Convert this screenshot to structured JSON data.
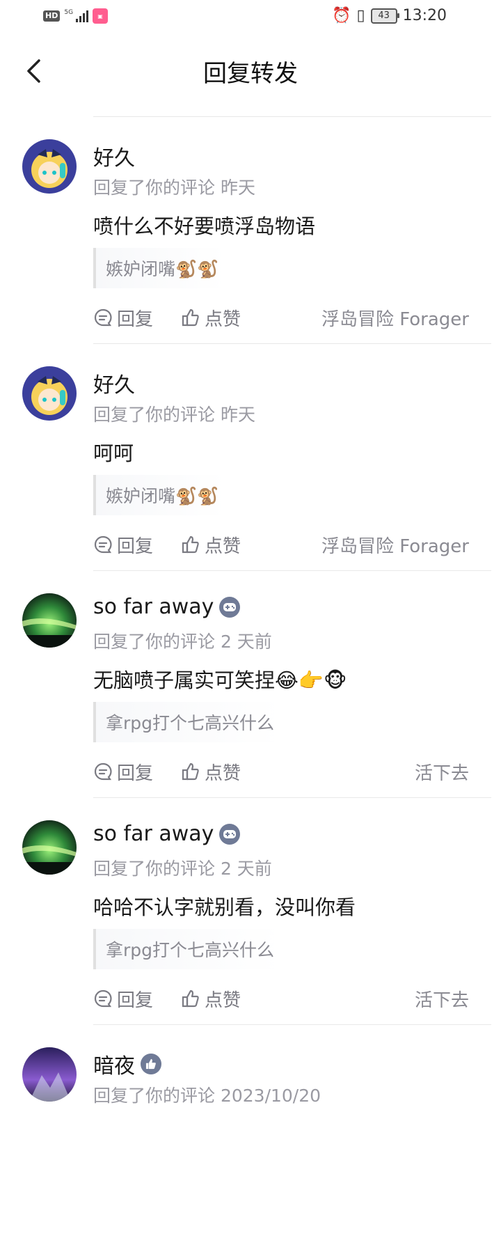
{
  "status_bar": {
    "hd": "HD",
    "network": "5G",
    "time": "13:20",
    "battery": "43"
  },
  "header": {
    "title": "回复转发"
  },
  "items": [
    {
      "name": "好久",
      "meta": "回复了你的评论 昨天",
      "text": "喷什么不好要喷浮岛物语",
      "quote": "嫉妒闭嘴🐒🐒",
      "reply_label": "回复",
      "like_label": "点赞",
      "source": "浮岛冒险 Forager",
      "avatar": "anime-girl-avatar"
    },
    {
      "name": "好久",
      "meta": "回复了你的评论 昨天",
      "text": "呵呵",
      "quote": "嫉妒闭嘴🐒🐒",
      "reply_label": "回复",
      "like_label": "点赞",
      "source": "浮岛冒险 Forager",
      "avatar": "anime-girl-avatar"
    },
    {
      "name": "so far away",
      "meta": "回复了你的评论 2 天前",
      "text": "无脑喷子属实可笑捏😂👉🐵",
      "quote": "拿rpg打个七高兴什么",
      "reply_label": "回复",
      "like_label": "点赞",
      "source": "活下去",
      "avatar": "aurora-avatar",
      "badge": "gamepad-icon"
    },
    {
      "name": "so far away",
      "meta": "回复了你的评论 2 天前",
      "text": "哈哈不认字就别看，没叫你看",
      "quote": "拿rpg打个七高兴什么",
      "reply_label": "回复",
      "like_label": "点赞",
      "source": "活下去",
      "avatar": "aurora-avatar",
      "badge": "gamepad-icon"
    },
    {
      "name": "暗夜",
      "meta": "回复了你的评论 2023/10/20",
      "avatar": "purple-aurora-avatar",
      "badge": "thumb-badge-icon"
    }
  ],
  "colors": {
    "accent_badge": "#6f7a96",
    "secondary_text": "#9a9aa2",
    "divider": "#e8e8e8"
  }
}
